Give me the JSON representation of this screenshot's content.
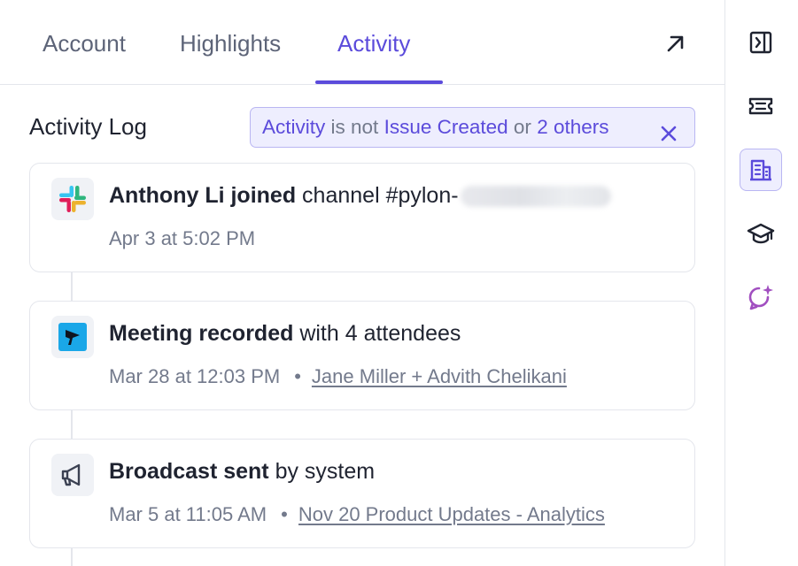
{
  "tabs": [
    {
      "label": "Account",
      "active": false
    },
    {
      "label": "Highlights",
      "active": false
    },
    {
      "label": "Activity",
      "active": true
    }
  ],
  "header": {
    "open_icon": "arrow-up-right-icon"
  },
  "activity_log": {
    "title": "Activity Log",
    "filter": {
      "field": "Activity",
      "operator": "is not",
      "value": "Issue Created",
      "joiner": "or",
      "extra": "2 others",
      "clear_icon": "close-icon"
    },
    "items": [
      {
        "app_icon": "slack-icon",
        "actor": "Anthony Li joined",
        "rest": "channel #pylon-",
        "redacted": true,
        "timestamp": "Apr 3 at 5:02 PM"
      },
      {
        "app_icon": "meeting-recorder-icon",
        "actor": "Meeting recorded",
        "rest": "with 4 attendees",
        "timestamp": "Mar 28 at 12:03 PM",
        "separator": "•",
        "link": "Jane Miller + Advith Chelikani"
      },
      {
        "app_icon": "megaphone-icon",
        "actor": "Broadcast sent",
        "rest": "by system",
        "timestamp": "Mar 5 at 11:05 AM",
        "separator": "•",
        "link": "Nov 20 Product Updates - Analytics"
      }
    ]
  },
  "rail": [
    {
      "icon": "panel-collapse-icon",
      "active": false
    },
    {
      "icon": "ticket-icon",
      "active": false
    },
    {
      "icon": "building-icon",
      "active": true
    },
    {
      "icon": "graduation-cap-icon",
      "active": false
    },
    {
      "icon": "ai-chat-sparkle-icon",
      "active": false
    }
  ],
  "colors": {
    "accent": "#5b4bdb",
    "text": "#1f2330",
    "muted": "#737a8c",
    "border": "#e4e6ec",
    "filter_bg": "#eeeefe",
    "ai_icon": "#a14fc0"
  }
}
